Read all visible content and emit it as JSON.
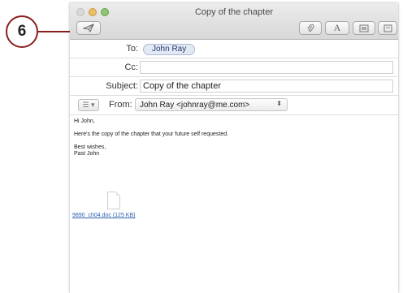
{
  "callout": {
    "number": "6"
  },
  "window": {
    "title": "Copy of the chapter"
  },
  "toolbar": {
    "send_icon": "paper-plane-icon",
    "attach_icon": "paperclip-icon",
    "format_label": "A",
    "photo_icon": "photo-icon",
    "template_icon": "stationery-icon"
  },
  "header": {
    "to_label": "To:",
    "to_recipient": "John Ray",
    "cc_label": "Cc:",
    "cc_value": "",
    "subject_label": "Subject:",
    "subject_value": "Copy of the chapter",
    "priority_icon": "list-icon",
    "from_label": "From:",
    "from_value": "John Ray <johnray@me.com>"
  },
  "body": {
    "greeting": "Hi John,",
    "line1": "Here's the copy of the chapter that your future self requested.",
    "closing": "Best wishes,",
    "signature": "Past John"
  },
  "attachment": {
    "icon": "document-icon",
    "link_text": "9890_ch04.doc (125 KB)"
  },
  "colors": {
    "callout_border": "#8a1e1e",
    "link": "#2b5fb0",
    "token_bg": "#e3e9f4"
  }
}
